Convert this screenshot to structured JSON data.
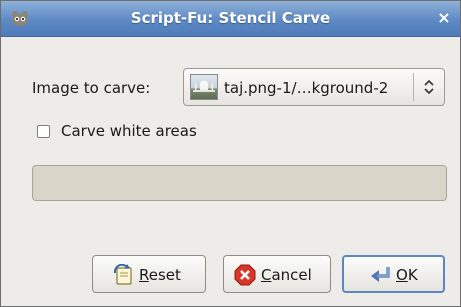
{
  "window": {
    "title": "Script-Fu: Stencil Carve",
    "close_glyph": "×"
  },
  "form": {
    "image_label": "Image to carve:",
    "image_value": "taj.png-1/…kground-2",
    "carve_white_label": "Carve white areas",
    "carve_white_checked": false,
    "progress_fraction": 0
  },
  "buttons": {
    "reset": {
      "mnemonic": "R",
      "rest": "eset"
    },
    "cancel": {
      "mnemonic": "C",
      "rest": "ancel"
    },
    "ok": {
      "mnemonic": "O",
      "rest": "K"
    }
  },
  "colors": {
    "titlebar": "#5d89c4",
    "window_bg": "#eeece8",
    "progress_trough": "#d9d5c9",
    "default_button_border": "#5c87c0"
  },
  "icons": {
    "app": "gimp-wilber-icon",
    "close": "close-icon",
    "thumbnail": "image-thumbnail",
    "combo": "up-down-chevron-icon",
    "reset": "reset-icon",
    "cancel": "cancel-icon",
    "ok": "ok-return-icon"
  }
}
